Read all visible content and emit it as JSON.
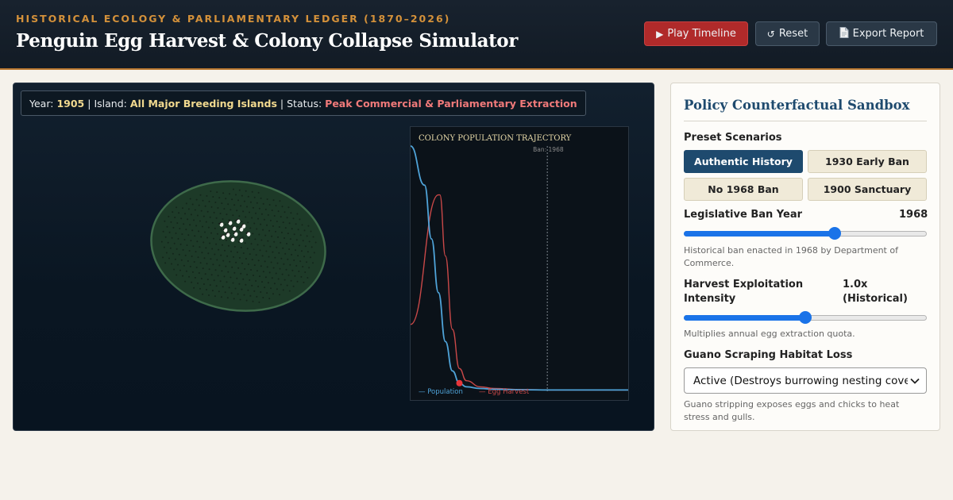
{
  "header": {
    "eyebrow": "HISTORICAL ECOLOGY & PARLIAMENTARY LEDGER (1870–2026)",
    "title": "Penguin Egg Harvest & Colony Collapse Simulator",
    "buttons": {
      "play": "Play Timeline",
      "reset": "Reset",
      "export": "Export Report"
    }
  },
  "status": {
    "year_label": "Year:",
    "year": "1905",
    "island_label": "Island:",
    "island": "All Major Breeding Islands",
    "status_label": "Status:",
    "status": "Peak Commercial & Parliamentary Extraction",
    "separator": "|"
  },
  "chart_data": {
    "type": "line",
    "title": "COLONY POPULATION TRAJECTORY",
    "annotations": [
      "Ban: 1968"
    ],
    "legend": [
      "— Population",
      "— Egg Harvest"
    ],
    "legend_position": "bottom-left",
    "xlim": [
      1870,
      2026
    ],
    "ban_year": 1968,
    "current_year": 1905,
    "series": [
      {
        "name": "Population",
        "color": "#4fa3d8",
        "x": [
          1870,
          1880,
          1885,
          1890,
          1895,
          1900,
          1905,
          1910,
          1920,
          1930,
          1950,
          1970,
          2026
        ],
        "values": [
          1.0,
          0.84,
          0.62,
          0.4,
          0.2,
          0.08,
          0.03,
          0.015,
          0.008,
          0.005,
          0.003,
          0.002,
          0.002
        ]
      },
      {
        "name": "Egg Harvest",
        "color": "#c94848",
        "x": [
          1870,
          1890,
          1891,
          1895,
          1900,
          1905,
          1910,
          1920,
          1930,
          1950,
          1970,
          2026
        ],
        "values": [
          0.27,
          0.8,
          0.8,
          0.55,
          0.25,
          0.09,
          0.04,
          0.015,
          0.008,
          0.004,
          0.002,
          0.002
        ]
      }
    ]
  },
  "sidebar": {
    "title": "Policy Counterfactual Sandbox",
    "presets_label": "Preset Scenarios",
    "presets": [
      {
        "label": "Authentic History",
        "active": true
      },
      {
        "label": "1930 Early Ban",
        "active": false
      },
      {
        "label": "No 1968 Ban",
        "active": false
      },
      {
        "label": "1900 Sanctuary",
        "active": false
      }
    ],
    "ban_year": {
      "label": "Legislative Ban Year",
      "value": "1968",
      "min": 1870,
      "max": 2026,
      "help": "Historical ban enacted in 1968 by Department of Commerce."
    },
    "intensity": {
      "label": "Harvest Exploitation Intensity",
      "value": "1.0x (Historical)",
      "fraction": 0.5,
      "help": "Multiplies annual egg extraction quota."
    },
    "guano": {
      "label": "Guano Scraping Habitat Loss",
      "selected": "Active (Destroys burrowing nesting cover)",
      "help": "Guano stripping exposes eggs and chicks to heat stress and gulls."
    }
  }
}
